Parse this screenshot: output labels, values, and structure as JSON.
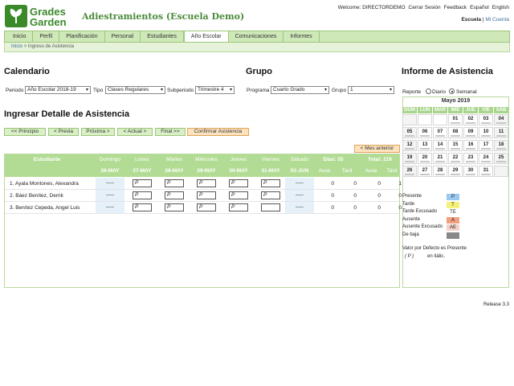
{
  "brand": {
    "name_line1": "Grades",
    "name_line2": "Garden",
    "title": "Adiestramientos (Escuela Demo)"
  },
  "toplinks": [
    "Welcome: DIRECTORDEMO",
    "Cerrar Sesión",
    "Feedback",
    "Español",
    "English"
  ],
  "sublinks": {
    "school": "Escuela",
    "sep": "|",
    "account": "Mi Cuenta"
  },
  "nav": [
    "Inicio",
    "Perfil",
    "Planificación",
    "Personal",
    "Estudiantes",
    "Año Escolar",
    "Comunicaciones",
    "Informes"
  ],
  "breadcrumb": {
    "home": "Inicio",
    "sep": ">",
    "current": "Ingreso de Asistencia"
  },
  "calendar_section": {
    "title": "Calendario",
    "periodo_label": "Periodo",
    "periodo_value": "Año Escolar 2018-19",
    "tipo_label": "Tipo",
    "tipo_value": "Clases Regulares",
    "sub_label": "Subperiodo",
    "sub_value": "Trimestre 4"
  },
  "grupo_section": {
    "title": "Grupo",
    "programa_label": "Programa",
    "programa_value": "Cuarto Grado",
    "grupo_label": "Grupo",
    "grupo_value": "1"
  },
  "informe": {
    "title": "Informe de Asistencia",
    "reporte_label": "Reporte",
    "diario": "Diario",
    "semanal": "Semanal"
  },
  "detail_title": "Ingresar Detalle de Asistencia",
  "buttons": {
    "principio": "<< Principio",
    "previa": "< Previa",
    "proxima": "Próxima >",
    "actual": "< Actual >",
    "final": "Final >>",
    "confirmar": "Confirmar Asistencia",
    "mes_anterior": "< Mes anterior"
  },
  "table": {
    "col_student": "Estudiante",
    "days": [
      {
        "name": "Domingo",
        "date": "26-MAY"
      },
      {
        "name": "Lunes",
        "date": "27-MAY"
      },
      {
        "name": "Martes",
        "date": "28-MAY"
      },
      {
        "name": "Miércoles",
        "date": "29-MAY"
      },
      {
        "name": "Jueves",
        "date": "30-MAY"
      },
      {
        "name": "Viernes",
        "date": "31-MAY"
      },
      {
        "name": "Sábado",
        "date": "01-JUN"
      }
    ],
    "dias": "Días: 55",
    "total": "Total: 219",
    "sub": [
      "Ause",
      "Tard",
      "Ause",
      "Tard"
    ],
    "dash": "-----",
    "input_value": "P",
    "rows": [
      {
        "name": "1. Ayala Montones, Alexandra",
        "stats": [
          "0",
          "0",
          "0",
          "1"
        ]
      },
      {
        "name": "2. Báez Benítez, Derrik",
        "stats": [
          "0",
          "0",
          "0",
          "0"
        ]
      },
      {
        "name": "3. Benítez Cepeda, Angel Luis",
        "stats": [
          "0",
          "0",
          "0",
          "0"
        ]
      }
    ]
  },
  "month": {
    "title": "Mayo 2019",
    "headers": [
      "DOM",
      "LUN",
      "MAR",
      "MIÉ",
      "JUE",
      "VIE",
      "SÁB"
    ],
    "weeks": [
      [
        "",
        "",
        "",
        "01",
        "02",
        "03",
        "04"
      ],
      [
        "05",
        "06",
        "07",
        "08",
        "09",
        "10",
        "11"
      ],
      [
        "12",
        "13",
        "14",
        "15",
        "16",
        "17",
        "18"
      ],
      [
        "19",
        "20",
        "21",
        "22",
        "23",
        "24",
        "25"
      ],
      [
        "26",
        "27",
        "28",
        "29",
        "30",
        "31",
        ""
      ]
    ]
  },
  "legend": [
    {
      "label": "Presente",
      "code": "P",
      "color": "#9cc8f0"
    },
    {
      "label": "Tarde",
      "code": "T",
      "color": "#f5f07a"
    },
    {
      "label": "Tarde Excusado",
      "code": "TE",
      "color": "#ffffff"
    },
    {
      "label": "Ausente",
      "code": "A",
      "color": "#f0a080"
    },
    {
      "label": "Ausente Excusado",
      "code": "AE",
      "color": "#f3d2c8"
    },
    {
      "label": "De baja",
      "code": "",
      "color": "#888888"
    }
  ],
  "default_note": {
    "line1": "Valor por Defecto es Presente",
    "code": "( P )",
    "line2": "en itálic."
  },
  "release": "Release 3.3"
}
